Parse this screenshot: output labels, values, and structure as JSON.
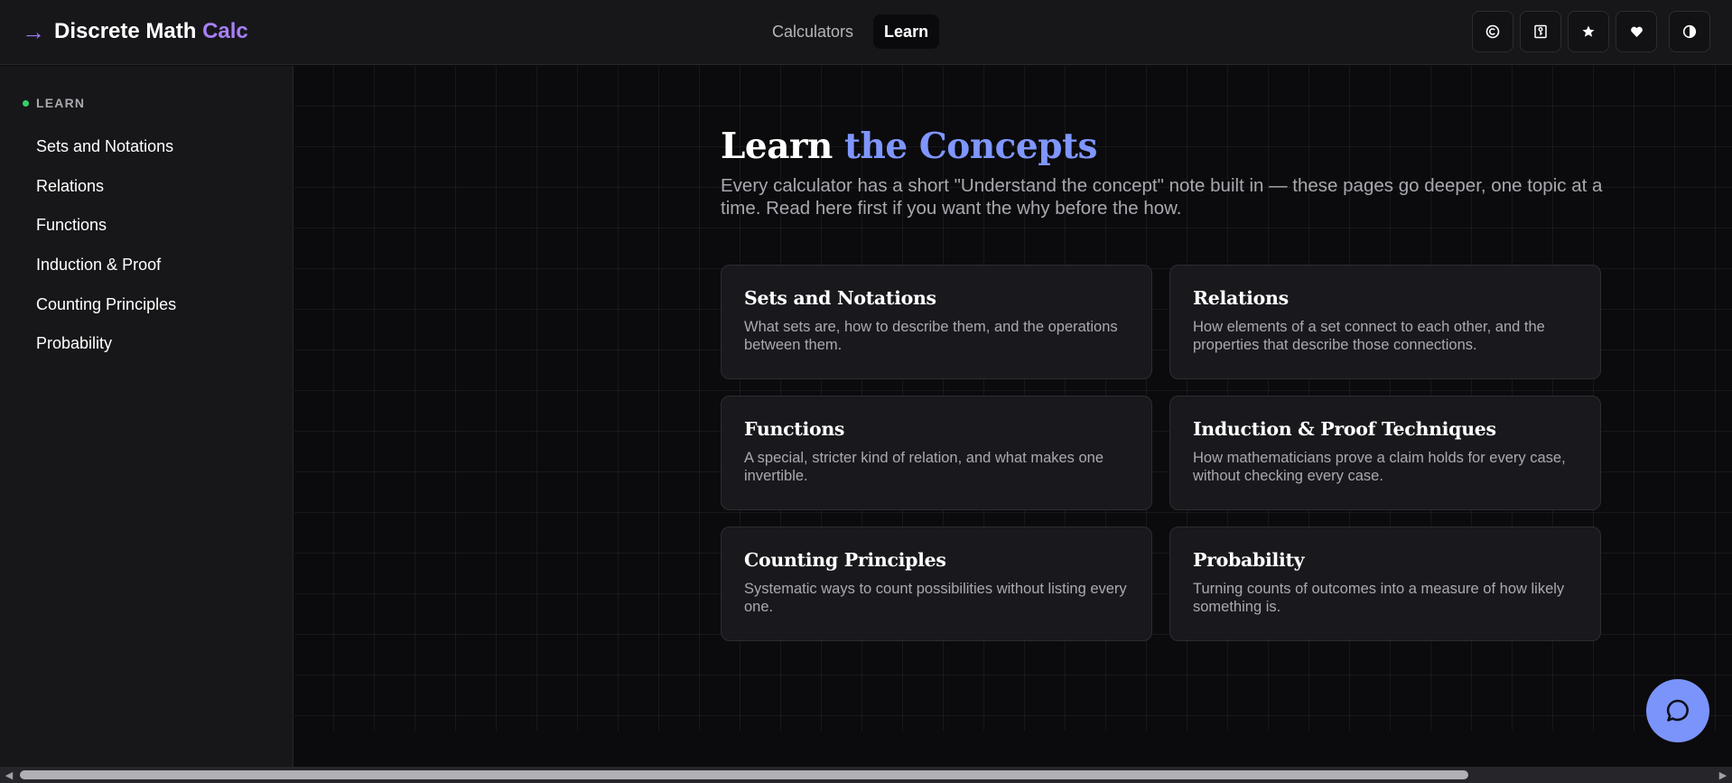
{
  "brand": {
    "arrow": "→",
    "name": "Discrete Math",
    "accent": "Calc"
  },
  "topnav": {
    "tabs": [
      {
        "label": "Calculators",
        "active": false
      },
      {
        "label": "Learn",
        "active": true
      }
    ]
  },
  "toolbar": {
    "icons": [
      "copyright-icon",
      "key-icon",
      "star-icon",
      "heart-icon",
      "contrast-icon"
    ]
  },
  "sidebar": {
    "heading": "LEARN",
    "items": [
      {
        "label": "Sets and Notations"
      },
      {
        "label": "Relations"
      },
      {
        "label": "Functions"
      },
      {
        "label": "Induction & Proof"
      },
      {
        "label": "Counting Principles"
      },
      {
        "label": "Probability"
      }
    ]
  },
  "main": {
    "title_plain": "Learn",
    "title_accent": "the Concepts",
    "intro": "Every calculator has a short \"Understand the concept\" note built in — these pages go deeper, one topic at a time. Read here first if you want the why before the how.",
    "cards": [
      {
        "title": "Sets and Notations",
        "description": "What sets are, how to describe them, and the operations between them."
      },
      {
        "title": "Relations",
        "description": "How elements of a set connect to each other, and the properties that describe those connections."
      },
      {
        "title": "Functions",
        "description": "A special, stricter kind of relation, and what makes one invertible."
      },
      {
        "title": "Induction & Proof Techniques",
        "description": "How mathematicians prove a claim holds for every case, without checking every case."
      },
      {
        "title": "Counting Principles",
        "description": "Systematic ways to count possibilities without listing every one."
      },
      {
        "title": "Probability",
        "description": "Turning counts of outcomes into a measure of how likely something is."
      }
    ]
  },
  "colors": {
    "accent_purple": "#a77ff5",
    "accent_blue": "#7f96ff",
    "status_green": "#34d06a",
    "chat_button": "#7b94fb"
  }
}
